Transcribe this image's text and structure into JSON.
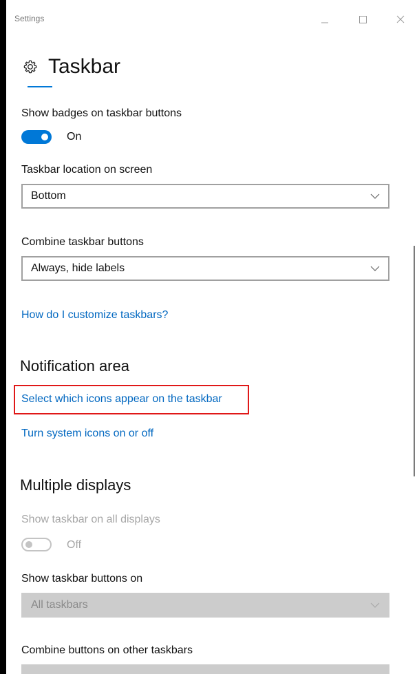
{
  "window": {
    "title": "Settings"
  },
  "page": {
    "title": "Taskbar"
  },
  "badges": {
    "label": "Show badges on taskbar buttons",
    "state": "On"
  },
  "location": {
    "label": "Taskbar location on screen",
    "value": "Bottom"
  },
  "combine": {
    "label": "Combine taskbar buttons",
    "value": "Always, hide labels"
  },
  "customize_link": "How do I customize taskbars?",
  "notification_area": {
    "heading": "Notification area",
    "select_icons_link": "Select which icons appear on the taskbar",
    "system_icons_link": "Turn system icons on or off"
  },
  "multiple_displays": {
    "heading": "Multiple displays",
    "show_all": {
      "label": "Show taskbar on all displays",
      "state": "Off"
    },
    "buttons_on": {
      "label": "Show taskbar buttons on",
      "value": "All taskbars"
    },
    "combine_other": {
      "label": "Combine buttons on other taskbars"
    }
  },
  "colors": {
    "accent": "#0078d7",
    "link": "#0067c0",
    "highlight": "#e01818",
    "disabled_text": "#a6a6a6"
  },
  "icons": {
    "header": "gear-icon",
    "minimize": "minimize-icon",
    "maximize": "maximize-icon",
    "close": "close-icon",
    "dropdown": "chevron-down-icon"
  }
}
